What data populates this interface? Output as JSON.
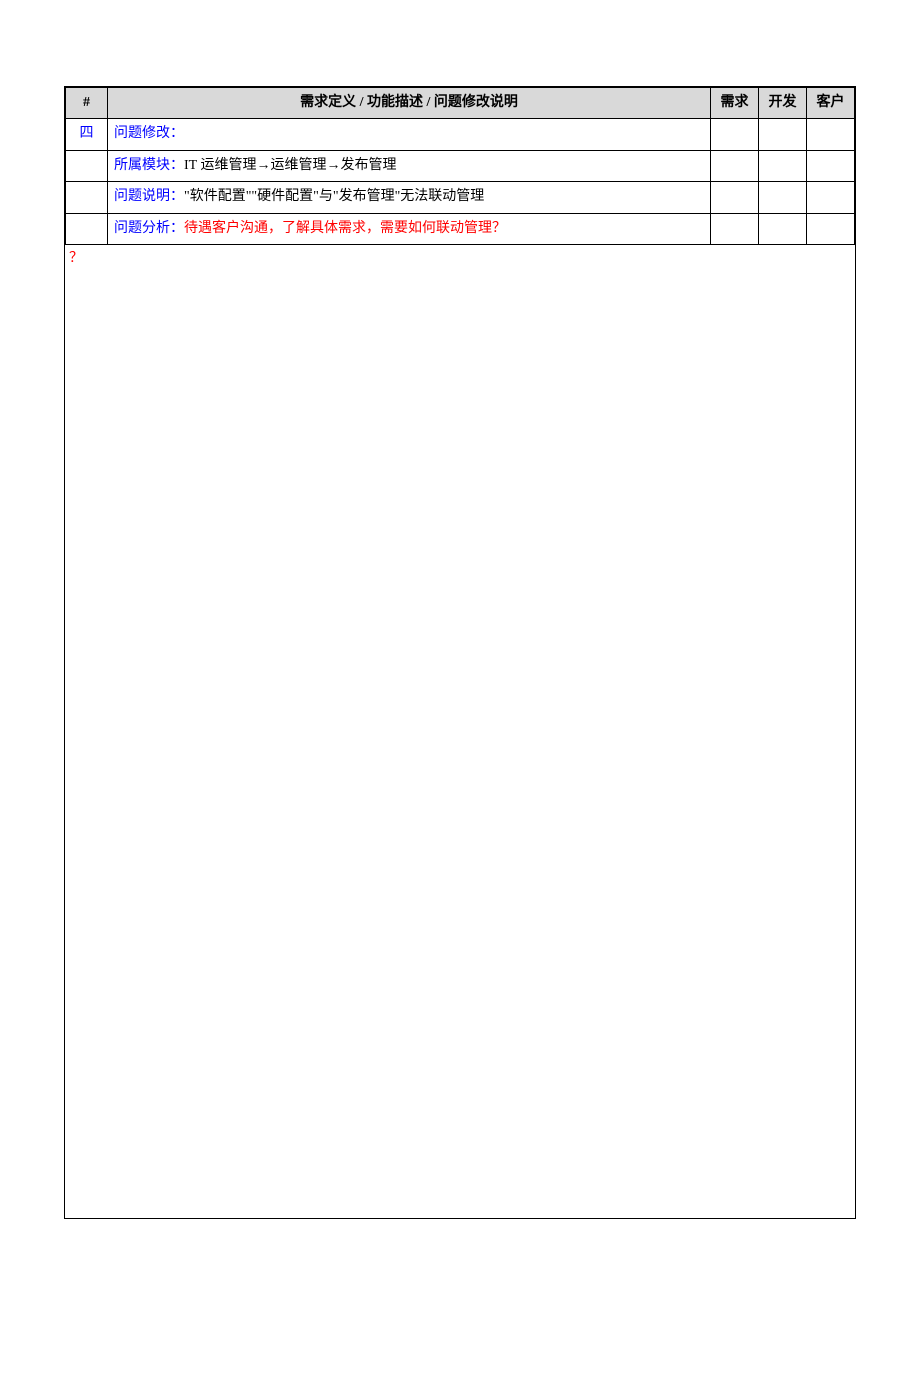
{
  "headers": {
    "num": "#",
    "desc": "需求定义 / 功能描述 / 问题修改说明",
    "req": "需求",
    "dev": "开发",
    "cust": "客户"
  },
  "rows": [
    {
      "num": "四",
      "num_class": "blue",
      "desc_prefix": "问题修改：",
      "desc_prefix_class": "blue",
      "desc_rest": ""
    },
    {
      "num": "",
      "desc_prefix": "所属模块：",
      "desc_prefix_class": "blue",
      "desc_rest": "IT 运维管理→运维管理→发布管理"
    },
    {
      "num": "",
      "desc_prefix": "问题说明：",
      "desc_prefix_class": "blue",
      "desc_rest": "\"软件配置\"\"硬件配置\"与\"发布管理\"无法联动管理"
    },
    {
      "num": "",
      "desc_prefix": "问题分析：",
      "desc_prefix_class": "blue",
      "desc_rest": "待遇客户沟通，了解具体需求，需要如何联动管理？",
      "desc_rest_class": "red"
    }
  ],
  "trailing": "？"
}
